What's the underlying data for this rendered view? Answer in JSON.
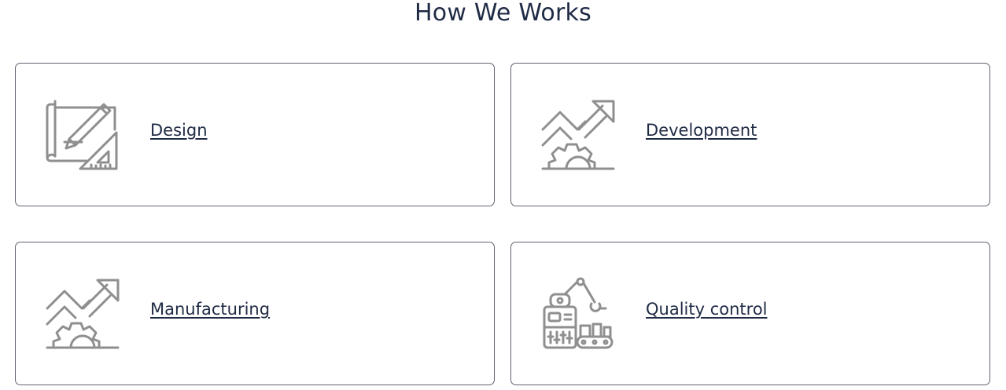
{
  "heading": "How We Works",
  "cards": [
    {
      "label": "Design",
      "icon": "blueprint-pencil-icon"
    },
    {
      "label": "Development",
      "icon": "gear-growth-arrow-icon"
    },
    {
      "label": "Manufacturing",
      "icon": "gear-growth-arrow-icon"
    },
    {
      "label": "Quality control",
      "icon": "robotic-arm-assembly-icon"
    }
  ]
}
